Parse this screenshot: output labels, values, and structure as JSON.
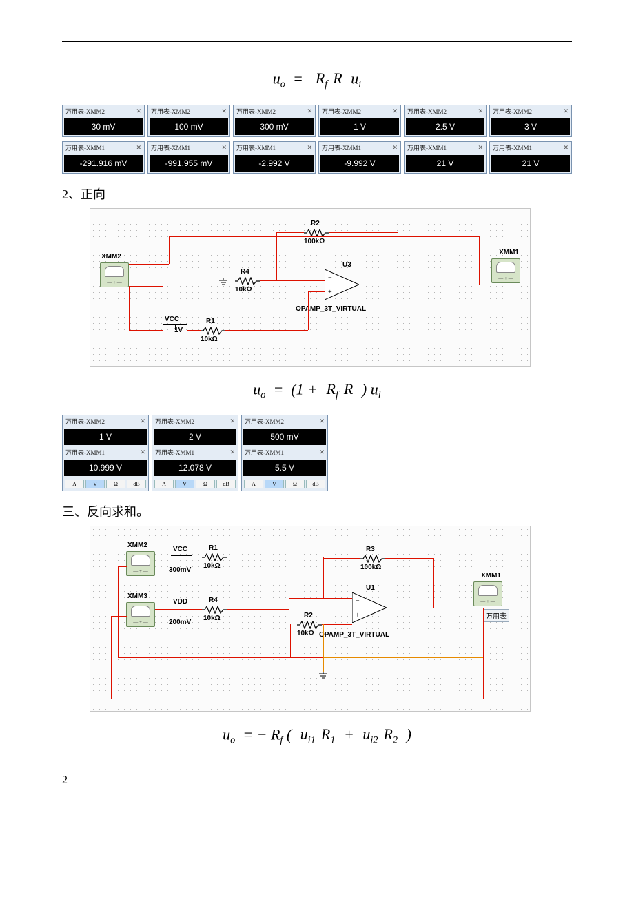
{
  "formulas": {
    "f1": {
      "lhs_var": "u",
      "lhs_sub": "o",
      "eq": "=",
      "num": "R",
      "num_sub": "f",
      "den": "R",
      "rhs_var": "u",
      "rhs_sub": "i"
    },
    "f2": {
      "lhs_var": "u",
      "lhs_sub": "o",
      "eq": "=",
      "pre": "(1 +",
      "num": "R",
      "num_sub": "f",
      "den": "R",
      "post": ")",
      "rhs_var": "u",
      "rhs_sub": "i"
    },
    "f3": {
      "lhs_var": "u",
      "lhs_sub": "o",
      "eq": "= −",
      "coef": "R",
      "coef_sub": "f",
      "open": "(",
      "n1": "u",
      "n1_sub": "i1",
      "d1": "R",
      "d1_sub": "1",
      "plus": "+",
      "n2": "u",
      "n2_sub": "i2",
      "d2": "R",
      "d2_sub": "2",
      "close": ")"
    }
  },
  "mm_label_xmm2": "万用表-XMM2",
  "mm_label_xmm1": "万用表-XMM1",
  "mm_close": "✕",
  "btns": {
    "A": "A",
    "V": "V",
    "O": "Ω",
    "dB": "dB"
  },
  "row1_top": [
    "30 mV",
    "100 mV",
    "300 mV",
    "1 V",
    "2.5 V",
    "3 V"
  ],
  "row1_bottom": [
    "-291.916 mV",
    "-991.955 mV",
    "-2.992 V",
    "-9.992 V",
    "21 V",
    "21 V"
  ],
  "headings": {
    "h2": "2、正向",
    "h3": "三、反向求和。"
  },
  "circuit1": {
    "r2": "R2",
    "r2v": "100kΩ",
    "r4": "R4",
    "r4v": "10kΩ",
    "r1": "R1",
    "r1v": "10kΩ",
    "u3": "U3",
    "op": "OPAMP_3T_VIRTUAL",
    "vcc": "VCC",
    "vccv": "1V",
    "xmm2": "XMM2",
    "xmm1": "XMM1"
  },
  "circuit2": {
    "r1": "R1",
    "r1v": "10kΩ",
    "r4": "R4",
    "r4v": "10kΩ",
    "r2": "R2",
    "r2v": "10kΩ",
    "r3": "R3",
    "r3v": "100kΩ",
    "u1": "U1",
    "op": "OPAMP_3T_VIRTUAL",
    "vcc": "VCC",
    "vccv": "300mV",
    "vdd": "VDD",
    "vddv": "200mV",
    "xmm1": "XMM1",
    "xmm2": "XMM2",
    "xmm3": "XMM3",
    "tip": "万用表"
  },
  "row2_top": [
    "1 V",
    "2 V",
    "500 mV"
  ],
  "row2_bottom": [
    "10.999 V",
    "12.078 V",
    "5.5 V"
  ],
  "page": "2"
}
